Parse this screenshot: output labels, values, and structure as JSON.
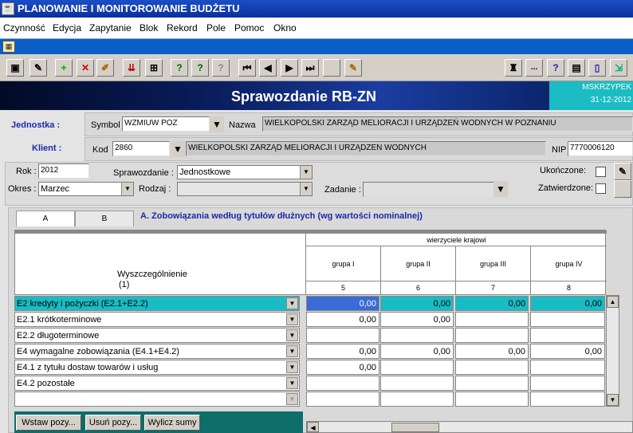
{
  "window": {
    "title": "PLANOWANIE I MONITOROWANIE BUDŻETU",
    "icon": "java-icon"
  },
  "menu": [
    "Czynność",
    "Edycja",
    "Zapytanie",
    "Blok",
    "Rekord",
    "Pole",
    "Pomoc",
    "Okno"
  ],
  "toolbar": {
    "more_label": "..."
  },
  "header": {
    "title": "Sprawozdanie RB-ZN",
    "user": "MSKRZYPEK",
    "date": "31-12-2012"
  },
  "jednostka": {
    "label": "Jednostka :",
    "symbol_label": "Symbol",
    "symbol": "WZMIUW POZ",
    "nazwa_label": "Nazwa",
    "nazwa": "WIELKOPOLSKI ZARZĄD MELIORACJI I URZĄDZEŃ WODNYCH W POZNANIU"
  },
  "klient": {
    "label": "Klient :",
    "kod_label": "Kod",
    "kod": "2860",
    "nazwa": "WIELKOPOLSKI ZARZĄD MELIORACJI I URZĄDZEN WODNYCH",
    "nip_label": "NIP",
    "nip": "7770006120"
  },
  "filters": {
    "rok_label": "Rok :",
    "rok": "2012",
    "sprawozdanie_label": "Sprawozdanie :",
    "sprawozdanie": "Jednostkowe",
    "okres_label": "Okres :",
    "okres": "Marzec",
    "rodzaj_label": "Rodzaj :",
    "rodzaj": "",
    "zadanie_label": "Zadanie :",
    "zadanie": "",
    "ukonczone_label": "Ukończone:",
    "zatwierdzone_label": "Zatwierdzone:"
  },
  "tabs": [
    "A",
    "B"
  ],
  "section_title": "A. Zobowiązania według tytułów dłużnych (wg wartości nominalnej)",
  "grid": {
    "desc_header": "Wyszczególnienie",
    "desc_num": "(1)",
    "group_header": "wierzyciele krajowi",
    "columns": [
      {
        "label": "grupa I",
        "num": "5"
      },
      {
        "label": "grupa II",
        "num": "6"
      },
      {
        "label": "grupa III",
        "num": "7"
      },
      {
        "label": "grupa IV",
        "num": "8"
      }
    ],
    "rows": [
      {
        "label": "E2 kredyty i pożyczki (E2.1+E2.2)",
        "values": [
          "0,00",
          "0,00",
          "0,00",
          "0,00"
        ]
      },
      {
        "label": "E2.1 krótkoterminowe",
        "values": [
          "0,00",
          "0,00",
          "",
          ""
        ]
      },
      {
        "label": "E2.2 długoterminowe",
        "values": [
          "",
          "",
          "",
          ""
        ]
      },
      {
        "label": "E4  wymagalne zobowiązania (E4.1+E4.2)",
        "values": [
          "0,00",
          "0,00",
          "0,00",
          "0,00"
        ]
      },
      {
        "label": "E4.1 z tytułu dostaw towarów i usług",
        "values": [
          "0,00",
          "",
          "",
          ""
        ]
      },
      {
        "label": "E4.2 pozostałe",
        "values": [
          "",
          "",
          "",
          ""
        ]
      },
      {
        "label": "",
        "values": [
          "",
          "",
          "",
          ""
        ]
      }
    ]
  },
  "buttons": {
    "wstaw": "Wstaw pozy...",
    "usun": "Usuń pozy...",
    "wylicz": "Wylicz sumy"
  },
  "colors": {
    "accent": "#19bcc4",
    "selection": "#3a6cd6",
    "label_blue": "#1a2aa8"
  }
}
